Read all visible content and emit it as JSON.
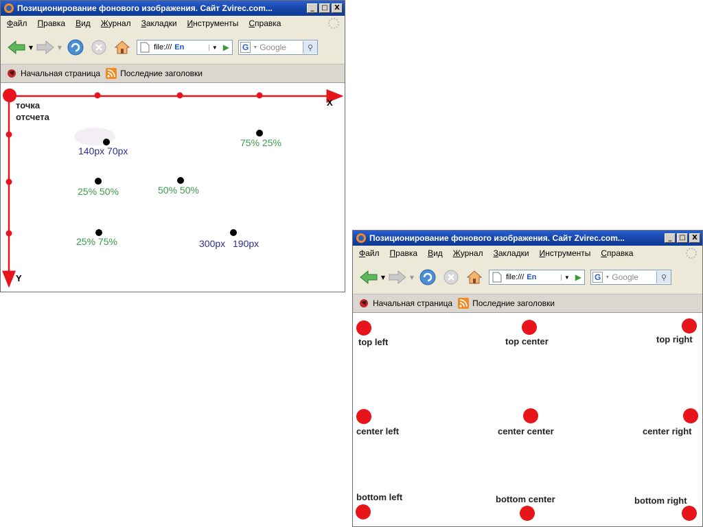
{
  "window_title": "Позиционирование фонового изображения. Сайт Zvirec.com...",
  "title_buttons": {
    "minimize": "_",
    "maximize": "□",
    "close": "X"
  },
  "menu": [
    "Файл",
    "Правка",
    "Вид",
    "Журнал",
    "Закладки",
    "Инструменты",
    "Справка"
  ],
  "nav": {
    "url": "file:///",
    "lang_badge": "En",
    "search_placeholder": "Google",
    "search_engine_letter": "G"
  },
  "bookmarks": [
    "Начальная страница",
    "Последние заголовки"
  ],
  "colors": {
    "axis": "#e8141c",
    "percent_label": "#3b9a4b",
    "px_label": "#2c2c92",
    "dot": "#000000",
    "title_bar": "#1545a8"
  },
  "window1": {
    "x_label": "X",
    "y_label": "Y",
    "origin_label_line1": "точка",
    "origin_label_line2": "отсчета",
    "labels": {
      "px1": "140px 70px",
      "p7525": "75% 25%",
      "p2550": "25% 50%",
      "p5050": "50% 50%",
      "p2575": "25% 75%",
      "px2a": "300px",
      "px2b": "190px"
    }
  },
  "window2": {
    "labels": {
      "tl": "top left",
      "tc": "top center",
      "tr": "top right",
      "cl": "center left",
      "cc": "center center",
      "cr": "center right",
      "bl": "bottom left",
      "bc": "bottom center",
      "br": "bottom right"
    }
  }
}
